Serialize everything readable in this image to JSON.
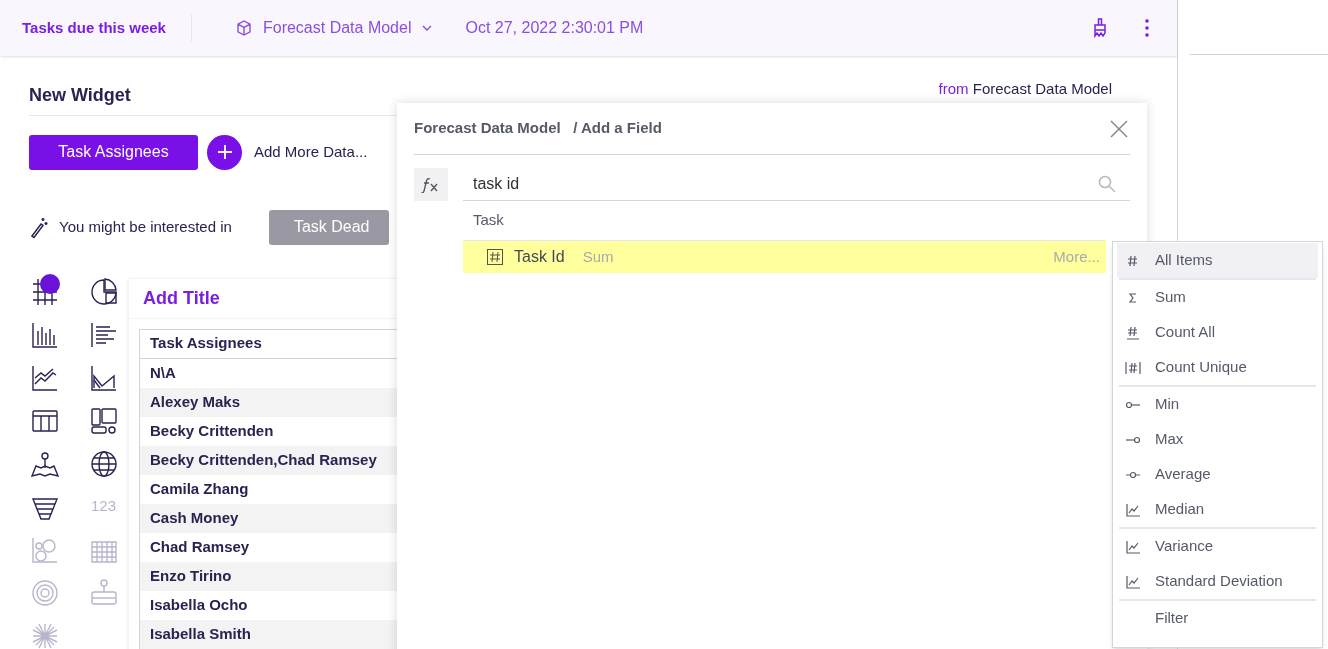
{
  "header": {
    "title": "Tasks due this week",
    "model": "Forecast Data Model",
    "timestamp": "Oct 27, 2022 2:30:01 PM"
  },
  "widget": {
    "title": "New Widget",
    "source_prefix": "from",
    "source": "Forecast Data Model",
    "data_button": "Task Assignees",
    "add_more": "Add More Data...",
    "suggestion": "You might be interested in",
    "suggested_button": "Task Dead",
    "card_title": "Add Title"
  },
  "chart_types": [
    {
      "kind": "grid",
      "selected": true,
      "disabled": false
    },
    {
      "kind": "pie",
      "selected": false,
      "disabled": false
    },
    {
      "kind": "bars",
      "selected": false,
      "disabled": false
    },
    {
      "kind": "hbars",
      "selected": false,
      "disabled": false
    },
    {
      "kind": "line",
      "selected": false,
      "disabled": false
    },
    {
      "kind": "area",
      "selected": false,
      "disabled": false
    },
    {
      "kind": "table",
      "selected": false,
      "disabled": false
    },
    {
      "kind": "layout",
      "selected": false,
      "disabled": false
    },
    {
      "kind": "map",
      "selected": false,
      "disabled": false
    },
    {
      "kind": "globe",
      "selected": false,
      "disabled": false
    },
    {
      "kind": "funnel",
      "selected": false,
      "disabled": false
    },
    {
      "kind": "number",
      "label": "123",
      "selected": false,
      "disabled": true
    },
    {
      "kind": "bubble",
      "selected": false,
      "disabled": true
    },
    {
      "kind": "heatmap",
      "selected": false,
      "disabled": true
    },
    {
      "kind": "radial",
      "selected": false,
      "disabled": true
    },
    {
      "kind": "tree",
      "selected": false,
      "disabled": true
    },
    {
      "kind": "burst",
      "selected": false,
      "disabled": true
    }
  ],
  "table": {
    "columns": [
      "Task Assignees"
    ],
    "rows": [
      "N\\A",
      "Alexey Maks",
      "Becky Crittenden",
      "Becky Crittenden,Chad Ramsey",
      "Camila Zhang",
      "Cash Money",
      "Chad Ramsey",
      "Enzo Tirino",
      "Isabella Ocho",
      "Isabella Smith"
    ]
  },
  "dialog": {
    "model": "Forecast Data Model",
    "title": "/ Add a Field",
    "search": "task id",
    "group": "Task",
    "field": {
      "name": "Task Id",
      "aggregation": "Sum",
      "more": "More...",
      "selected": true
    }
  },
  "menu": {
    "sections": [
      [
        {
          "kind": "hash",
          "label": "All Items",
          "selected": true
        }
      ],
      [
        {
          "kind": "sigma",
          "label": "Sum",
          "selected": false
        },
        {
          "kind": "hashunder",
          "label": "Count All",
          "selected": false
        },
        {
          "kind": "hashbars",
          "label": "Count Unique",
          "selected": false
        }
      ],
      [
        {
          "kind": "min",
          "label": "Min",
          "selected": false
        },
        {
          "kind": "max",
          "label": "Max",
          "selected": false
        },
        {
          "kind": "avg",
          "label": "Average",
          "selected": false
        },
        {
          "kind": "trend",
          "label": "Median",
          "selected": false
        }
      ],
      [
        {
          "kind": "trend",
          "label": "Variance",
          "selected": false
        },
        {
          "kind": "trend",
          "label": "Standard Deviation",
          "selected": false
        }
      ],
      [
        {
          "kind": "plain",
          "label": "Filter",
          "selected": false
        }
      ]
    ]
  }
}
